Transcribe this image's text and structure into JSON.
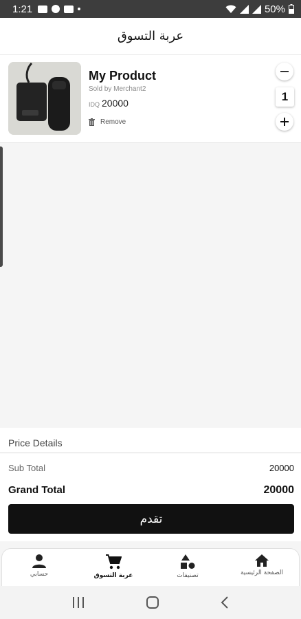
{
  "status_bar": {
    "time": "1:21",
    "battery": "50%",
    "left_icons": [
      "youtube-icon",
      "facebook-icon",
      "youtube-icon",
      "dot-icon"
    ],
    "right_icons": [
      "wifi-icon",
      "signal-icon",
      "signal-icon",
      "battery-icon"
    ]
  },
  "header": {
    "title": "عربة التسوق"
  },
  "cart": {
    "items": [
      {
        "name": "My Product",
        "seller": "Sold by Merchant2",
        "currency": "IDQ",
        "price": "20000",
        "remove_label": "Remove",
        "quantity": "1"
      }
    ]
  },
  "price_details": {
    "title": "Price Details",
    "subtotal_label": "Sub Total",
    "subtotal_value": "20000",
    "grand_total_label": "Grand Total",
    "grand_total_value": "20000",
    "checkout_label": "تقدم"
  },
  "bottom_nav": {
    "items": [
      {
        "label": "الصفحة الرئيسية",
        "icon": "home-icon"
      },
      {
        "label": "تصنيفات",
        "icon": "categories-icon"
      },
      {
        "label": "عربة التسوق",
        "icon": "cart-icon",
        "active": true
      },
      {
        "label": "حسابي",
        "icon": "account-icon"
      }
    ]
  },
  "colors": {
    "primary": "#111111",
    "background": "#f5f5f5",
    "status_bar": "#3d3d3d"
  }
}
